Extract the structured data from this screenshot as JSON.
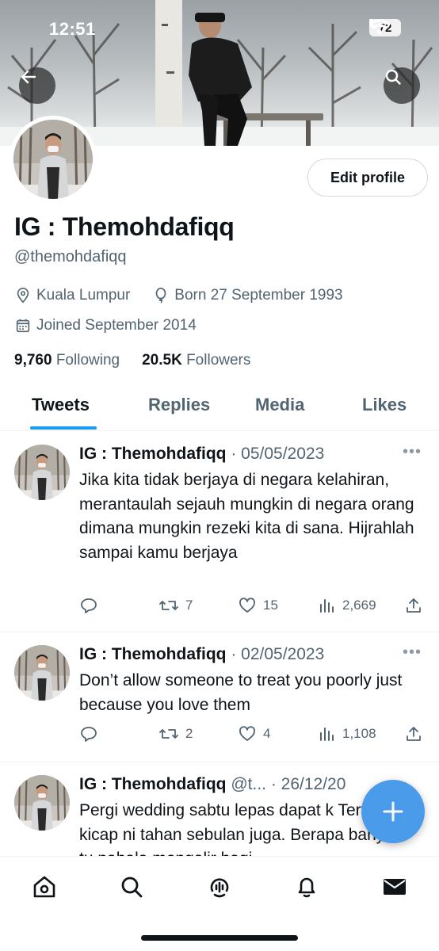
{
  "status_bar": {
    "time": "12:51",
    "battery": "72"
  },
  "profile": {
    "name": "IG : Themohdafiqq",
    "handle": "@themohdafiqq",
    "location": "Kuala Lumpur",
    "birthday": "Born 27 September 1993",
    "joined": "Joined September 2014",
    "following_count": "9,760",
    "following_label": "Following",
    "followers_count": "20.5K",
    "followers_label": "Followers",
    "edit_label": "Edit profile"
  },
  "tabs": [
    {
      "label": "Tweets"
    },
    {
      "label": "Replies"
    },
    {
      "label": "Media"
    },
    {
      "label": "Likes"
    }
  ],
  "tweets": [
    {
      "name": "IG : Themohdafiqq",
      "handle": "",
      "date": "· 05/05/2023",
      "text": "Jika kita tidak berjaya di negara kelahiran, merantaulah sejauh mungkin di negara orang dimana mungkin rezeki kita di sana. Hijrahlah sampai kamu berjaya",
      "retweets": "7",
      "likes": "15",
      "views": "2,669"
    },
    {
      "name": "IG : Themohdafiqq",
      "handle": "",
      "date": "· 02/05/2023",
      "text": "Don’t allow someone to treat you poorly just because you love them",
      "retweets": "2",
      "likes": "4",
      "views": "1,108"
    },
    {
      "name": "IG : Themohdafiqq",
      "handle": "@t...",
      "date": "· 26/12/20",
      "text": "Pergi wedding sabtu lepas dapat k Terfikir kicap ni tahan sebulan juga. Berapa banyak tu pahala mengalir bagi",
      "retweets": "",
      "likes": "",
      "views": ""
    }
  ],
  "icons": {
    "back": "arrow-left-icon",
    "search": "search-icon",
    "location": "location-pin-icon",
    "birthday": "balloon-icon",
    "joined": "calendar-icon",
    "reply": "reply-icon",
    "retweet": "retweet-icon",
    "like": "heart-icon",
    "views": "views-icon",
    "share": "share-icon",
    "more": "more-icon",
    "compose": "plus-icon"
  },
  "nav": [
    {
      "name": "home"
    },
    {
      "name": "search"
    },
    {
      "name": "spaces"
    },
    {
      "name": "notifications"
    },
    {
      "name": "messages"
    }
  ],
  "colors": {
    "accent": "#1d9bf0",
    "fab": "#4a9cea",
    "text": "#0f1419",
    "secondary": "#536471"
  }
}
